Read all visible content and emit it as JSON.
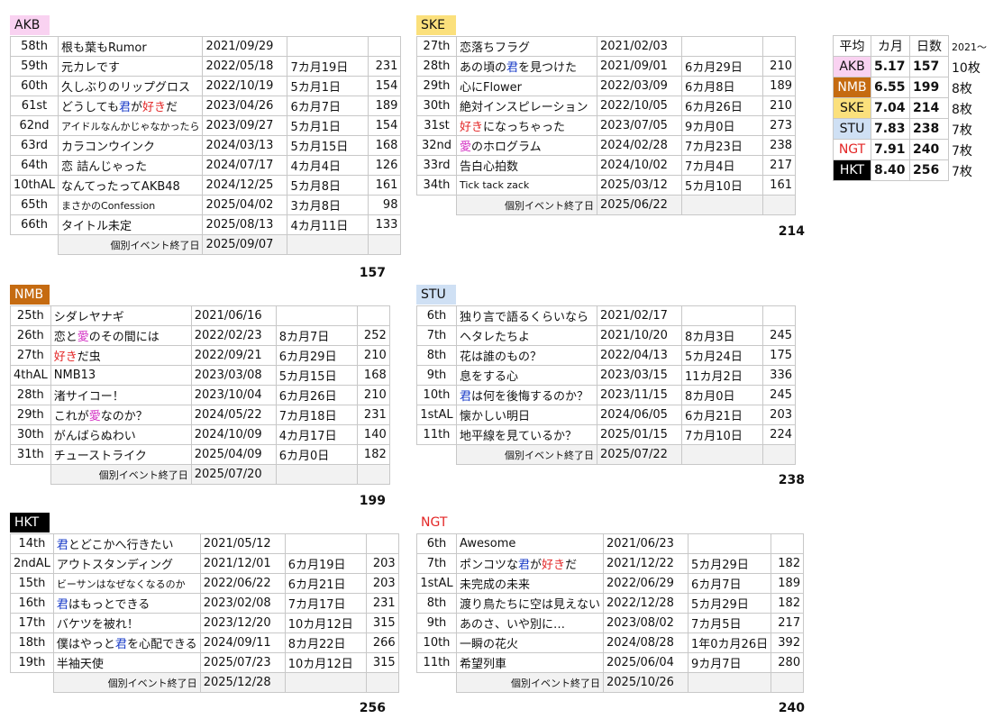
{
  "colors": {
    "akb": "#f9d2f1",
    "nmb": "#c56b11",
    "ske": "#fbe07c",
    "stu": "#cfe0f4",
    "ngt_text": "#e32626",
    "hkt": "#000000",
    "kimi": "#1a3cc8",
    "suki": "#e32626",
    "ai": "#d433c4"
  },
  "groups": {
    "akb": {
      "label": "AKB",
      "total": "157",
      "end_label": "個別イベント終了日",
      "end_date": "2025/09/07",
      "rows": [
        [
          "58th",
          "根も葉もRumor",
          "2021/09/29",
          "",
          ""
        ],
        [
          "59th",
          "元カレです",
          "2022/05/18",
          "7カ月19日",
          "231"
        ],
        [
          "60th",
          "久しぶりのリップグロス",
          "2022/10/19",
          "5カ月1日",
          "154"
        ],
        [
          "61st",
          "どうしても君が好きだ",
          "2023/04/26",
          "6カ月7日",
          "189"
        ],
        [
          "62nd",
          "アイドルなんかじゃなかったら",
          "2023/09/27",
          "5カ月1日",
          "154"
        ],
        [
          "63rd",
          "カラコンウインク",
          "2024/03/13",
          "5カ月15日",
          "168"
        ],
        [
          "64th",
          "恋 詰んじゃった",
          "2024/07/17",
          "4カ月4日",
          "126"
        ],
        [
          "10thAL",
          "なんてったってAKB48",
          "2024/12/25",
          "5カ月8日",
          "161"
        ],
        [
          "65th",
          "まさかのConfession",
          "2025/04/02",
          "3カ月8日",
          "98"
        ],
        [
          "66th",
          "タイトル未定",
          "2025/08/13",
          "4カ月11日",
          "133"
        ]
      ]
    },
    "ske": {
      "label": "SKE",
      "total": "214",
      "end_label": "個別イベント終了日",
      "end_date": "2025/06/22",
      "rows": [
        [
          "27th",
          "恋落ちフラグ",
          "2021/02/03",
          "",
          ""
        ],
        [
          "28th",
          "あの頃の君を見つけた",
          "2021/09/01",
          "6カ月29日",
          "210"
        ],
        [
          "29th",
          "心にFlower",
          "2022/03/09",
          "6カ月8日",
          "189"
        ],
        [
          "30th",
          "絶対インスピレーション",
          "2022/10/05",
          "6カ月26日",
          "210"
        ],
        [
          "31st",
          "好きになっちゃった",
          "2023/07/05",
          "9カ月0日",
          "273"
        ],
        [
          "32nd",
          "愛のホログラム",
          "2024/02/28",
          "7カ月23日",
          "238"
        ],
        [
          "33rd",
          "告白心拍数",
          "2024/10/02",
          "7カ月4日",
          "217"
        ],
        [
          "34th",
          "Tick tack zack",
          "2025/03/12",
          "5カ月10日",
          "161"
        ]
      ]
    },
    "nmb": {
      "label": "NMB",
      "total": "199",
      "end_label": "個別イベント終了日",
      "end_date": "2025/07/20",
      "rows": [
        [
          "25th",
          "シダレヤナギ",
          "2021/06/16",
          "",
          ""
        ],
        [
          "26th",
          "恋と愛のその間には",
          "2022/02/23",
          "8カ月7日",
          "252"
        ],
        [
          "27th",
          "好きだ虫",
          "2022/09/21",
          "6カ月29日",
          "210"
        ],
        [
          "4thAL",
          "NMB13",
          "2023/03/08",
          "5カ月15日",
          "168"
        ],
        [
          "28th",
          "渚サイコー！",
          "2023/10/04",
          "6カ月26日",
          "210"
        ],
        [
          "29th",
          "これが愛なのか？",
          "2024/05/22",
          "7カ月18日",
          "231"
        ],
        [
          "30th",
          "がんばらぬわい",
          "2024/10/09",
          "4カ月17日",
          "140"
        ],
        [
          "31th",
          "チューストライク",
          "2025/04/09",
          "6カ月0日",
          "182"
        ]
      ]
    },
    "stu": {
      "label": "STU",
      "total": "238",
      "end_label": "個別イベント終了日",
      "end_date": "2025/07/22",
      "rows": [
        [
          "6th",
          "独り言で語るくらいなら",
          "2021/02/17",
          "",
          ""
        ],
        [
          "7th",
          "ヘタレたちよ",
          "2021/10/20",
          "8カ月3日",
          "245"
        ],
        [
          "8th",
          "花は誰のもの？",
          "2022/04/13",
          "5カ月24日",
          "175"
        ],
        [
          "9th",
          "息をする心",
          "2023/03/15",
          "11カ月2日",
          "336"
        ],
        [
          "10th",
          "君は何を後悔するのか？",
          "2023/11/15",
          "8カ月0日",
          "245"
        ],
        [
          "1stAL",
          "懐かしい明日",
          "2024/06/05",
          "6カ月21日",
          "203"
        ],
        [
          "11th",
          "地平線を見ているか？",
          "2025/01/15",
          "7カ月10日",
          "224"
        ]
      ]
    },
    "hkt": {
      "label": "HKT",
      "total": "256",
      "end_label": "個別イベント終了日",
      "end_date": "2025/12/28",
      "rows": [
        [
          "14th",
          "君とどこかへ行きたい",
          "2021/05/12",
          "",
          ""
        ],
        [
          "2ndAL",
          "アウトスタンディング",
          "2021/12/01",
          "6カ月19日",
          "203"
        ],
        [
          "15th",
          "ビーサンはなぜなくなるのか",
          "2022/06/22",
          "6カ月21日",
          "203"
        ],
        [
          "16th",
          "君はもっとできる",
          "2023/02/08",
          "7カ月17日",
          "231"
        ],
        [
          "17th",
          "バケツを被れ！",
          "2023/12/20",
          "10カ月12日",
          "315"
        ],
        [
          "18th",
          "僕はやっと君を心配できる",
          "2024/09/11",
          "8カ月22日",
          "266"
        ],
        [
          "19th",
          "半袖天使",
          "2025/07/23",
          "10カ月12日",
          "315"
        ]
      ]
    },
    "ngt": {
      "label": "NGT",
      "total": "240",
      "end_label": "個別イベント終了日",
      "end_date": "2025/10/26",
      "rows": [
        [
          "6th",
          "Awesome",
          "2021/06/23",
          "",
          ""
        ],
        [
          "7th",
          "ポンコツな君が好きだ",
          "2021/12/22",
          "5カ月29日",
          "182"
        ],
        [
          "1stAL",
          "未完成の未来",
          "2022/06/29",
          "6カ月7日",
          "189"
        ],
        [
          "8th",
          "渡り鳥たちに空は見えない",
          "2022/12/28",
          "5カ月29日",
          "182"
        ],
        [
          "9th",
          "あのさ、いや別に…",
          "2023/08/02",
          "7カ月5日",
          "217"
        ],
        [
          "10th",
          "一瞬の花火",
          "2024/08/28",
          "1年0カ月26日",
          "392"
        ],
        [
          "11th",
          "希望列車",
          "2025/06/04",
          "9カ月7日",
          "280"
        ]
      ]
    }
  },
  "summary": {
    "headers": [
      "平均",
      "カ月",
      "日数"
    ],
    "note": "2021～",
    "rows": [
      {
        "group": "AKB",
        "months": "5.17",
        "days": "157",
        "count": "10枚"
      },
      {
        "group": "NMB",
        "months": "6.55",
        "days": "199",
        "count": "8枚"
      },
      {
        "group": "SKE",
        "months": "7.04",
        "days": "214",
        "count": "8枚"
      },
      {
        "group": "STU",
        "months": "7.83",
        "days": "238",
        "count": "7枚"
      },
      {
        "group": "NGT",
        "months": "7.91",
        "days": "240",
        "count": "7枚"
      },
      {
        "group": "HKT",
        "months": "8.40",
        "days": "256",
        "count": "7枚"
      }
    ]
  }
}
